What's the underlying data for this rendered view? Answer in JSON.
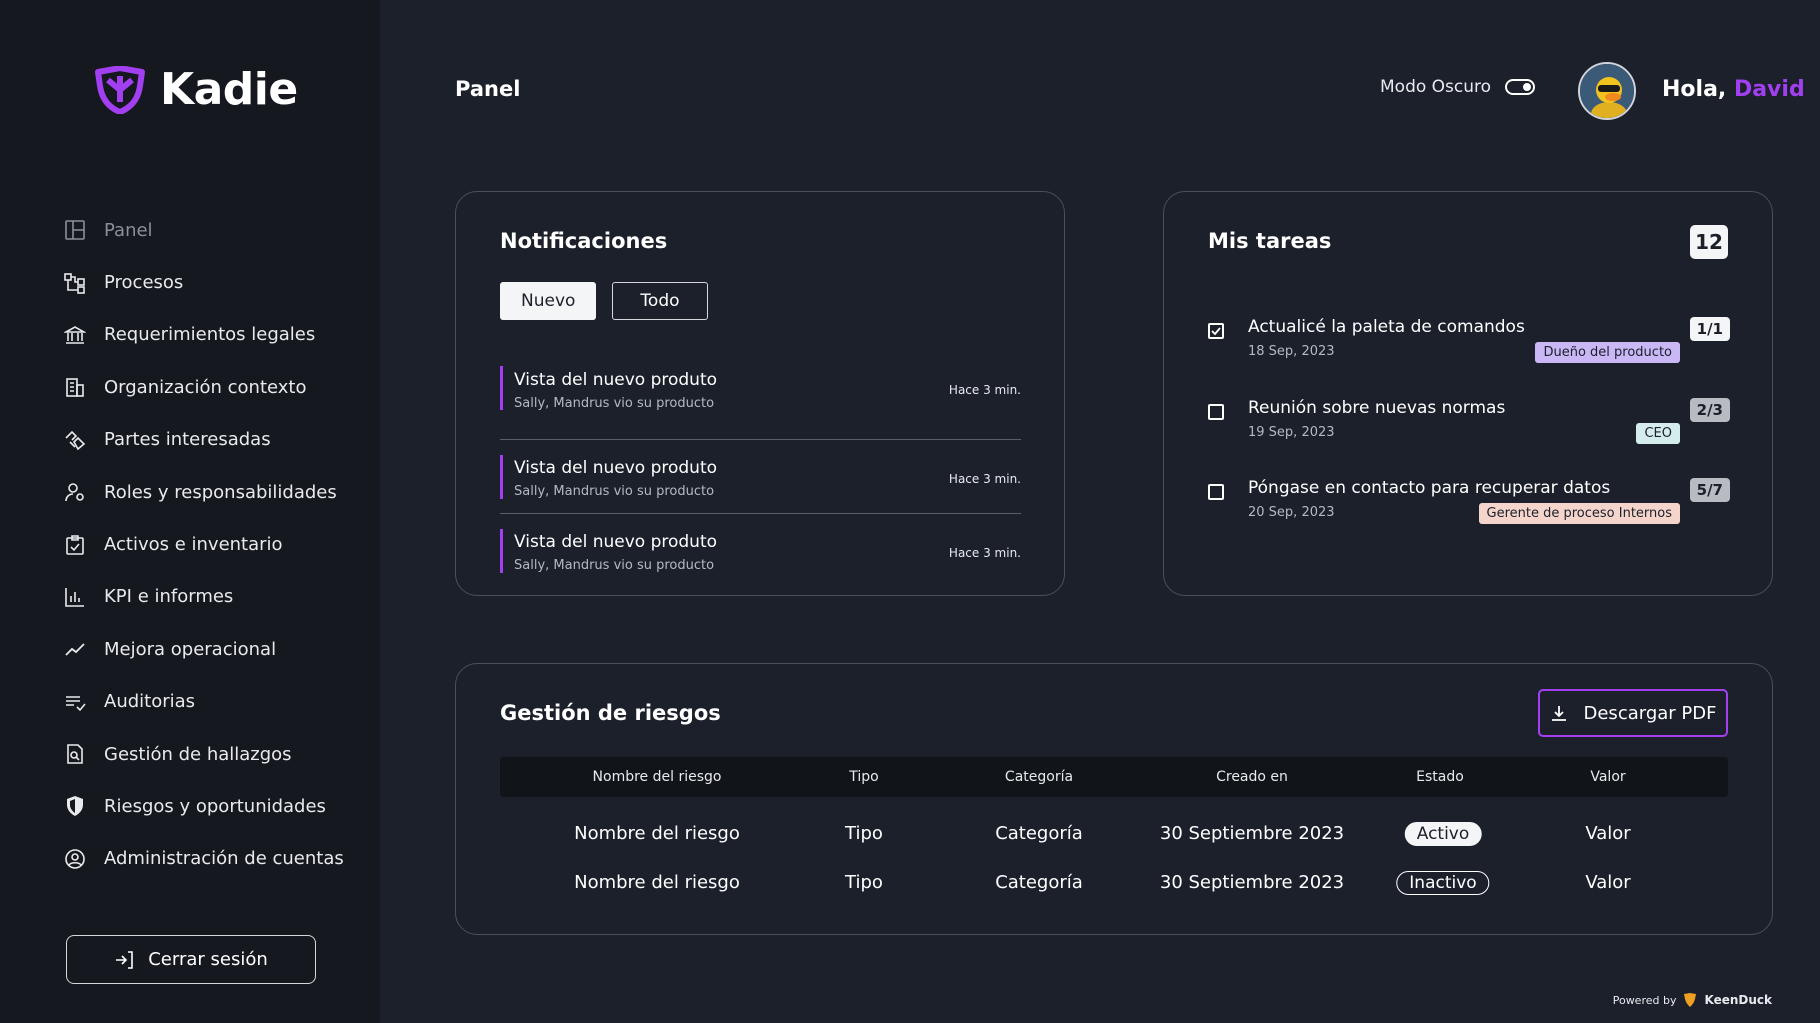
{
  "app": {
    "name": "Kadie",
    "accent": "#a23ff0"
  },
  "sidebar": {
    "items": [
      {
        "label": "Panel",
        "icon": "layout-icon"
      },
      {
        "label": "Procesos",
        "icon": "flow-icon"
      },
      {
        "label": "Requerimientos legales",
        "icon": "bank-icon"
      },
      {
        "label": "Organización contexto",
        "icon": "building-icon"
      },
      {
        "label": "Partes interesadas",
        "icon": "handshake-icon"
      },
      {
        "label": "Roles y responsabilidades",
        "icon": "user-gear-icon"
      },
      {
        "label": "Activos e inventario",
        "icon": "clipboard-check-icon"
      },
      {
        "label": "KPI e informes",
        "icon": "bar-chart-icon"
      },
      {
        "label": "Mejora operacional",
        "icon": "trend-line-icon"
      },
      {
        "label": "Auditorias",
        "icon": "list-check-icon"
      },
      {
        "label": "Gestión de hallazgos",
        "icon": "file-search-icon"
      },
      {
        "label": "Riesgos y oportunidades",
        "icon": "shield-icon"
      },
      {
        "label": "Administración de cuentas",
        "icon": "user-circle-icon"
      }
    ],
    "logout_label": "Cerrar sesión"
  },
  "header": {
    "title": "Panel",
    "dark_mode_label": "Modo Oscuro",
    "greeting_prefix": "Hola,",
    "user_name": "David"
  },
  "notifications": {
    "title": "Notificaciones",
    "tabs": [
      "Nuevo",
      "Todo"
    ],
    "items": [
      {
        "title": "Vista del nuevo produto",
        "subtitle": "Sally, Mandrus vio su producto",
        "time": "Hace 3 min."
      },
      {
        "title": "Vista del nuevo produto",
        "subtitle": "Sally, Mandrus vio su producto",
        "time": "Hace 3 min."
      },
      {
        "title": "Vista del nuevo produto",
        "subtitle": "Sally, Mandrus vio su producto",
        "time": "Hace 3 min."
      }
    ]
  },
  "tasks": {
    "title": "Mis tareas",
    "count": "12",
    "items": [
      {
        "title": "Actualicé la paleta de comandos",
        "date": "18 Sep, 2023",
        "ratio": "1/1",
        "tag": "Dueño del producto",
        "tag_color": "#c9b8f5",
        "checked": true
      },
      {
        "title": "Reunión sobre nuevas normas",
        "date": "19 Sep, 2023",
        "ratio": "2/3",
        "tag": "CEO",
        "tag_color": "#d4ecec",
        "checked": false
      },
      {
        "title": "Póngase en contacto para recuperar datos",
        "date": "20 Sep, 2023",
        "ratio": "5/7",
        "tag": "Gerente de proceso Internos",
        "tag_color": "#f5d5cb",
        "checked": false
      }
    ]
  },
  "risks": {
    "title": "Gestión de riesgos",
    "download_label": "Descargar PDF",
    "columns": [
      "Nombre del riesgo",
      "Tipo",
      "Categoría",
      "Creado en",
      "Estado",
      "Valor"
    ],
    "rows": [
      {
        "name": "Nombre del riesgo",
        "type": "Tipo",
        "category": "Categoría",
        "created": "30 Septiembre 2023",
        "status": "Activo",
        "value": "Valor"
      },
      {
        "name": "Nombre del riesgo",
        "type": "Tipo",
        "category": "Categoría",
        "created": "30 Septiembre 2023",
        "status": "Inactivo",
        "value": "Valor"
      }
    ]
  },
  "footer": {
    "powered_by": "Powered by",
    "brand": "KeenDuck"
  }
}
